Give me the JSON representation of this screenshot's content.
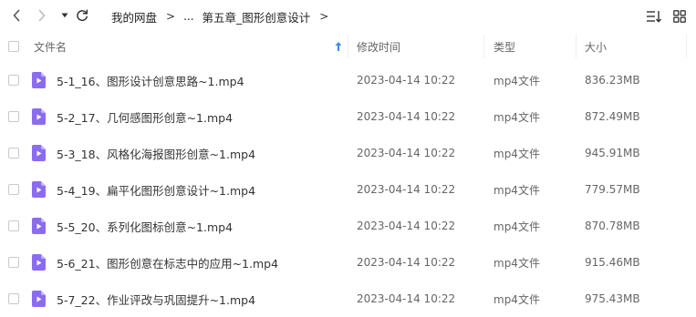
{
  "toolbar": {
    "back_icon": "chevron-left-icon",
    "forward_icon": "chevron-right-icon",
    "history_icon": "caret-down-icon",
    "refresh_icon": "refresh-icon",
    "sort_view_icon": "sort-list-icon",
    "grid_view_icon": "grid-icon"
  },
  "breadcrumb": {
    "root": "我的网盘",
    "separator": ">",
    "ellipsis": "...",
    "current": "第五章_图形创意设计"
  },
  "header": {
    "name": "文件名",
    "modified": "修改时间",
    "type": "类型",
    "size": "大小",
    "sort_icon": "sort-ascending-icon"
  },
  "colors": {
    "file_icon": "#8b6cf0",
    "sort_arrow": "#3b8bea",
    "text_primary": "#333333",
    "text_secondary": "#666666"
  },
  "files": [
    {
      "name": "5-1_16、图形设计创意思路~1.mp4",
      "modified": "2023-04-14 10:22",
      "type": "mp4文件",
      "size": "836.23MB"
    },
    {
      "name": "5-2_17、几何感图形创意~1.mp4",
      "modified": "2023-04-14 10:22",
      "type": "mp4文件",
      "size": "872.49MB"
    },
    {
      "name": "5-3_18、风格化海报图形创意~1.mp4",
      "modified": "2023-04-14 10:22",
      "type": "mp4文件",
      "size": "945.91MB"
    },
    {
      "name": "5-4_19、扁平化图形创意设计~1.mp4",
      "modified": "2023-04-14 10:22",
      "type": "mp4文件",
      "size": "779.57MB"
    },
    {
      "name": "5-5_20、系列化图标创意~1.mp4",
      "modified": "2023-04-14 10:22",
      "type": "mp4文件",
      "size": "870.78MB"
    },
    {
      "name": "5-6_21、图形创意在标志中的应用~1.mp4",
      "modified": "2023-04-14 10:22",
      "type": "mp4文件",
      "size": "915.46MB"
    },
    {
      "name": "5-7_22、作业评改与巩固提升~1.mp4",
      "modified": "2023-04-14 10:22",
      "type": "mp4文件",
      "size": "975.43MB"
    }
  ]
}
